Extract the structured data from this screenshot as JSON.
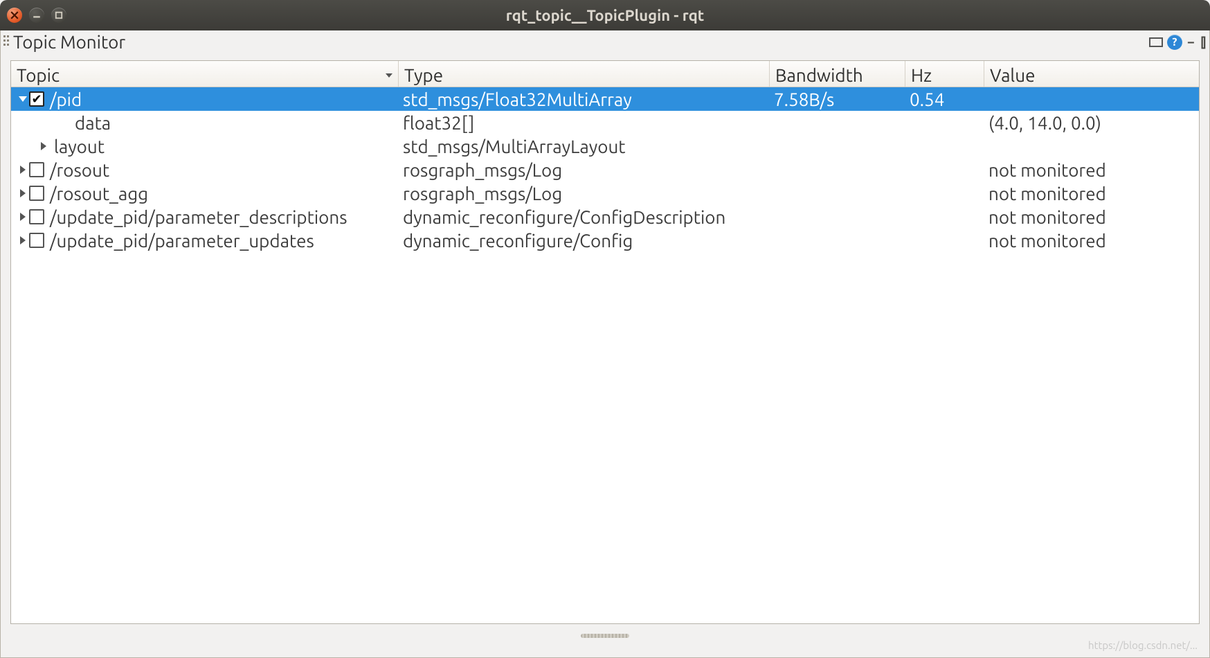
{
  "window": {
    "title": "rqt_topic__TopicPlugin - rqt"
  },
  "dock": {
    "title": "Topic Monitor"
  },
  "columns": {
    "topic": "Topic",
    "type": "Type",
    "bandwidth": "Bandwidth",
    "hz": "Hz",
    "value": "Value"
  },
  "rows": [
    {
      "indent": 0,
      "expander": "down",
      "checkbox": true,
      "checked": true,
      "selected": true,
      "topic": "/pid",
      "type": "std_msgs/Float32MultiArray",
      "bandwidth": "7.58B/s",
      "hz": "0.54",
      "value": ""
    },
    {
      "indent": 2,
      "expander": "none",
      "checkbox": false,
      "checked": false,
      "selected": false,
      "topic": "data",
      "type": "float32[]",
      "bandwidth": "",
      "hz": "",
      "value": "(4.0, 14.0, 0.0)"
    },
    {
      "indent": 1,
      "expander": "right",
      "checkbox": false,
      "checked": false,
      "selected": false,
      "topic": "layout",
      "type": "std_msgs/MultiArrayLayout",
      "bandwidth": "",
      "hz": "",
      "value": ""
    },
    {
      "indent": 0,
      "expander": "right",
      "checkbox": true,
      "checked": false,
      "selected": false,
      "topic": "/rosout",
      "type": "rosgraph_msgs/Log",
      "bandwidth": "",
      "hz": "",
      "value": "not monitored"
    },
    {
      "indent": 0,
      "expander": "right",
      "checkbox": true,
      "checked": false,
      "selected": false,
      "topic": "/rosout_agg",
      "type": "rosgraph_msgs/Log",
      "bandwidth": "",
      "hz": "",
      "value": "not monitored"
    },
    {
      "indent": 0,
      "expander": "right",
      "checkbox": true,
      "checked": false,
      "selected": false,
      "topic": "/update_pid/parameter_descriptions",
      "type": "dynamic_reconfigure/ConfigDescription",
      "bandwidth": "",
      "hz": "",
      "value": "not monitored"
    },
    {
      "indent": 0,
      "expander": "right",
      "checkbox": true,
      "checked": false,
      "selected": false,
      "topic": "/update_pid/parameter_updates",
      "type": "dynamic_reconfigure/Config",
      "bandwidth": "",
      "hz": "",
      "value": "not monitored"
    }
  ],
  "watermark": "https://blog.csdn.net/..."
}
